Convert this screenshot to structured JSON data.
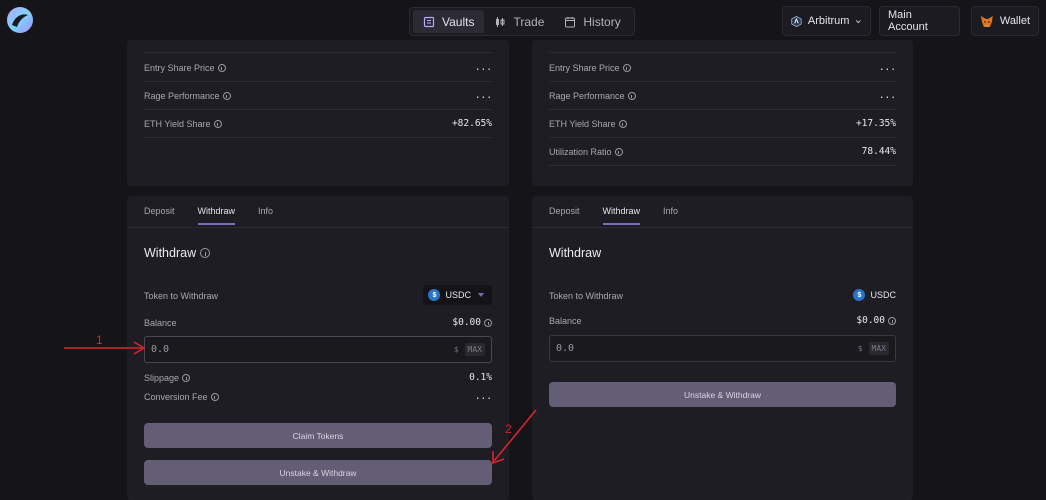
{
  "nav": {
    "items": [
      {
        "label": "Vaults",
        "icon": "vault-icon",
        "active": true
      },
      {
        "label": "Trade",
        "icon": "candlestick-icon",
        "active": false
      },
      {
        "label": "History",
        "icon": "history-icon",
        "active": false
      }
    ]
  },
  "header": {
    "network": "Arbitrum",
    "account": "Main Account",
    "wallet": "Wallet"
  },
  "left_vault": {
    "stats": [
      {
        "label": "Entry Share Price",
        "value": "..."
      },
      {
        "label": "Rage Performance",
        "value": "..."
      },
      {
        "label": "ETH Yield Share",
        "value": "+82.65%"
      }
    ],
    "tabs": [
      "Deposit",
      "Withdraw",
      "Info"
    ],
    "active_tab": "Withdraw",
    "heading": "Withdraw",
    "token_label": "Token to Withdraw",
    "token": "USDC",
    "balance_label": "Balance",
    "balance": "$0.00",
    "input_placeholder": "0.0",
    "input_suffix": "$",
    "max_label": "MAX",
    "slippage_label": "Slippage",
    "slippage": "0.1%",
    "fee_label": "Conversion Fee",
    "fee": "...",
    "claim_button": "Claim Tokens",
    "unstake_button": "Unstake & Withdraw"
  },
  "right_vault": {
    "stats": [
      {
        "label": "Entry Share Price",
        "value": "..."
      },
      {
        "label": "Rage Performance",
        "value": "..."
      },
      {
        "label": "ETH Yield Share",
        "value": "+17.35%"
      },
      {
        "label": "Utilization Ratio",
        "value": "78.44%"
      }
    ],
    "tabs": [
      "Deposit",
      "Withdraw",
      "Info"
    ],
    "active_tab": "Withdraw",
    "heading": "Withdraw",
    "token_label": "Token to Withdraw",
    "token": "USDC",
    "balance_label": "Balance",
    "balance": "$0.00",
    "input_placeholder": "0.0",
    "input_suffix": "$",
    "max_label": "MAX",
    "unstake_button": "Unstake & Withdraw"
  },
  "annotations": {
    "marker_1": "1",
    "marker_2": "2",
    "color": "#d9262a"
  },
  "colors": {
    "background": "#151418",
    "card": "#1e1d23",
    "accent": "#7b6bb8",
    "button": "#635d76"
  }
}
